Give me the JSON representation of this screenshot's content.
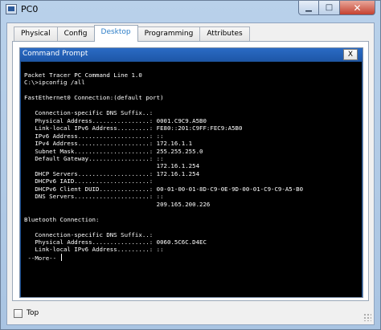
{
  "window": {
    "title": "PC0"
  },
  "tabs": [
    {
      "label": "Physical",
      "active": false
    },
    {
      "label": "Config",
      "active": false
    },
    {
      "label": "Desktop",
      "active": true
    },
    {
      "label": "Programming",
      "active": false
    },
    {
      "label": "Attributes",
      "active": false
    }
  ],
  "command_prompt": {
    "title": "Command Prompt",
    "close_label": "X",
    "lines": [
      "Packet Tracer PC Command Line 1.0",
      "C:\\>ipconfig /all",
      "",
      "FastEthernet0 Connection:(default port)",
      "",
      "   Connection-specific DNS Suffix..:",
      "   Physical Address................: 0001.C9C9.A5B0",
      "   Link-local IPv6 Address.........: FE80::201:C9FF:FEC9:A5B0",
      "   IPv6 Address....................: ::",
      "   IPv4 Address....................: 172.16.1.1",
      "   Subnet Mask.....................: 255.255.255.0",
      "   Default Gateway.................: ::",
      "                                     172.16.1.254",
      "   DHCP Servers....................: 172.16.1.254",
      "   DHCPv6 IAID.....................:",
      "   DHCPv6 Client DUID..............: 00-01-00-01-8D-C9-0E-9D-00-01-C9-C9-A5-B0",
      "   DNS Servers.....................: ::",
      "                                     209.165.200.226",
      "",
      "Bluetooth Connection:",
      "",
      "   Connection-specific DNS Suffix..:",
      "   Physical Address................: 0060.5C6C.D4EC",
      "   Link-local IPv6 Address.........: ::",
      " --More--"
    ]
  },
  "footer": {
    "top_label": "Top",
    "top_checked": false
  },
  "colors": {
    "cmd_titlebar": "#1e57a8",
    "console_bg": "#000000",
    "console_fg": "#ffffff",
    "active_tab_text": "#2f7fc8"
  },
  "icons": {
    "app": "pc-icon",
    "minimize": "minimize-icon",
    "maximize": "maximize-icon",
    "close": "close-icon"
  }
}
